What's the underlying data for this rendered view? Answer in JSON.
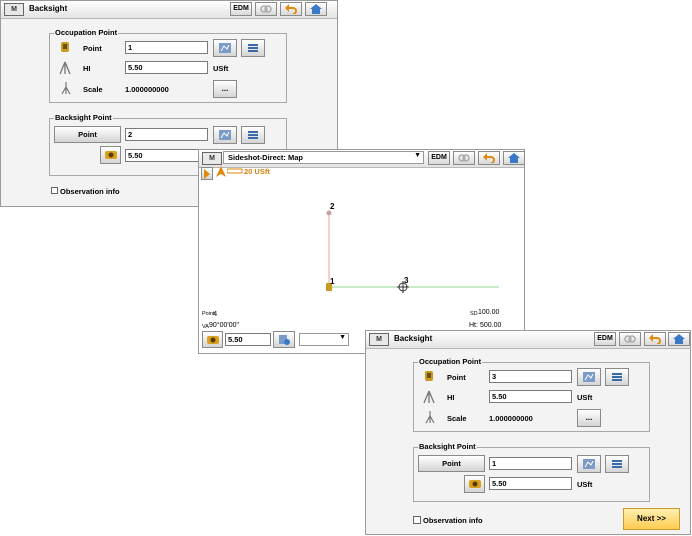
{
  "win1": {
    "title": "Backsight",
    "edm": "EDM",
    "occupation_group": "Occupation Point",
    "point_label": "Point",
    "point_value": "1",
    "hi_label": "HI",
    "hi_value": "5.50",
    "hi_unit": "USft",
    "scale_label": "Scale",
    "scale_value": "1.000000000",
    "more_label": "...",
    "backsight_group": "Backsight Point",
    "bs_point_button": "Point",
    "bs_point_value": "2",
    "bs_height_value": "5.50",
    "obs_info": "Observation info"
  },
  "win2": {
    "title": "Sideshot-Direct: Map",
    "edm": "EDM",
    "scale_text": "20 USft",
    "pt_labels": [
      "2",
      "1",
      "3"
    ],
    "point_readout_label": "Point",
    "point_readout_value": "4",
    "va_label": "VA",
    "va_value": "90°00'00\"",
    "sd_label": "SD",
    "sd_value": "100.00",
    "ht_label": "Ht:",
    "ht_value": "500.00",
    "height_value": "5.50"
  },
  "win3": {
    "title": "Backsight",
    "edm": "EDM",
    "occupation_group": "Occupation Point",
    "point_label": "Point",
    "point_value": "3",
    "hi_label": "HI",
    "hi_value": "5.50",
    "hi_unit": "USft",
    "scale_label": "Scale",
    "scale_value": "1.000000000",
    "more_label": "...",
    "backsight_group": "Backsight Point",
    "bs_point_button": "Point",
    "bs_point_value": "1",
    "bs_height_value": "5.50",
    "bs_height_unit": "USft",
    "obs_info": "Observation info",
    "next_button": "Next >>"
  },
  "colors": {
    "accent_orange": "#f0a020",
    "next_bg": "#ffd870",
    "toolbar_blue": "#3a78c8"
  },
  "icons": [
    "gps-receiver-icon",
    "tripod-icon",
    "rod-icon",
    "map-icon",
    "list-icon",
    "prism-icon",
    "undo-icon",
    "home-icon",
    "link-icon"
  ]
}
